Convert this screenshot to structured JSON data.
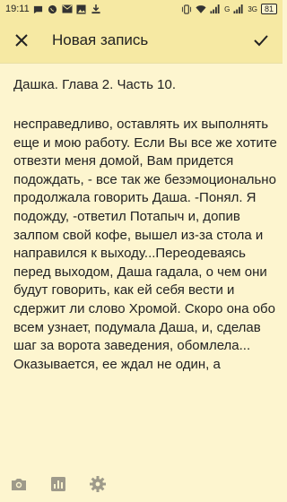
{
  "status_bar": {
    "time": "19:11",
    "network_label": "G",
    "network_label_2": "3G",
    "battery": "81",
    "icons": [
      "message-icon",
      "whatsapp-icon",
      "mail-icon",
      "gallery-icon",
      "download-icon",
      "vibrate-icon",
      "wifi-icon",
      "signal-icon",
      "signal-icon-2",
      "battery-icon"
    ]
  },
  "toolbar": {
    "title": "Новая запись",
    "close_icon": "close-icon",
    "confirm_icon": "check-icon"
  },
  "note": {
    "title": "Дашка. Глава 2. Часть 10.",
    "body": "несправедливо, оставлять их выполнять еще и мою работу. Если Вы все же хотите отвезти меня домой, Вам придется подождать, - все так же безэмоционально продолжала говорить Даша. -Понял. Я подожду, -ответил Потапыч и, допив залпом свой кофе, вышел из-за стола и направился к выходу...Переодеваясь перед выходом, Даша гадала, о чем они будут говорить, как ей себя вести и сдержит ли слово Хромой. Скоро она обо всем узнает, подумала Даша, и, сделав шаг за ворота заведения, обомлела... Оказывается, ее ждал не один, а"
  },
  "bottom_bar": {
    "icons": [
      "camera-icon",
      "chart-icon",
      "settings-icon"
    ]
  },
  "colors": {
    "background": "#fdf5cf",
    "bar": "#f6e9a3",
    "text": "#222222",
    "icon": "#9e9a8a"
  }
}
